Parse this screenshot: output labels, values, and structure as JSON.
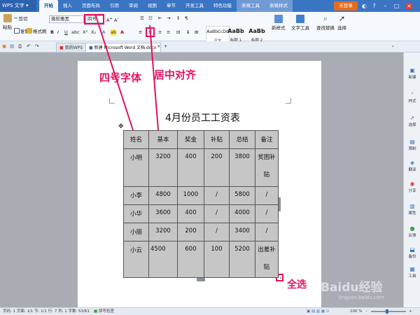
{
  "app": {
    "name": "WPS 文字"
  },
  "tabs": [
    "开始",
    "插入",
    "页面布局",
    "引用",
    "审阅",
    "视图",
    "章节",
    "开发工具",
    "特色功能",
    "表格工具",
    "表格样式"
  ],
  "login_label": "未登录",
  "ribbon": {
    "paste": "粘贴",
    "cut": "剪切",
    "copy": "复制",
    "format_painter": "格式刷",
    "font_name": "微软雅黑",
    "font_size": "四号",
    "styles": [
      {
        "preview": "AaBbCcDd",
        "name": "正文"
      },
      {
        "preview": "AaBb",
        "name": "标题 1"
      },
      {
        "preview": "AaBb",
        "name": "标题 2"
      }
    ],
    "new_style": "新样式",
    "text_tools": "文字工具",
    "find_replace": "查找替换",
    "select": "选择"
  },
  "doc_tabs": [
    "我的WPS",
    "新建 Microsoft Word 文档.docx"
  ],
  "annotations": {
    "font_size_note": "四号字体",
    "align_note": "居中对齐",
    "select_all_note": "全选"
  },
  "document": {
    "title": "4月份员工工资表",
    "table": {
      "headers": [
        "姓名",
        "基本",
        "奖金",
        "补贴",
        "总结",
        "备注"
      ],
      "rows": [
        [
          "小明",
          "3200",
          "400",
          "200",
          "3800",
          "贫困补贴"
        ],
        [
          "小李",
          "4800",
          "1000",
          "/",
          "5800",
          "/"
        ],
        [
          "小华",
          "3600",
          "400",
          "/",
          "4000",
          "/"
        ],
        [
          "小丽",
          "3200",
          "200",
          "/",
          "3400",
          "/"
        ],
        [
          "小云",
          "4500",
          "600",
          "100",
          "5200",
          "出差补贴"
        ]
      ]
    }
  },
  "sidebar": [
    "新建",
    "样式",
    "选择",
    "限制",
    "翻译",
    "分享",
    "属性",
    "反馈",
    "备份",
    "工具"
  ],
  "status": {
    "left": "页码: 1  页面: 1/1  节: 1/1  行: 7  列: 1  字数: 53/61",
    "spell": "拼写检查",
    "zoom": "100 %"
  },
  "watermark": {
    "brand": "Baidu经验",
    "url": "jingyan.baidu.com"
  },
  "colors": {
    "accent": "#3a75c4",
    "annotation": "#e5105c"
  }
}
